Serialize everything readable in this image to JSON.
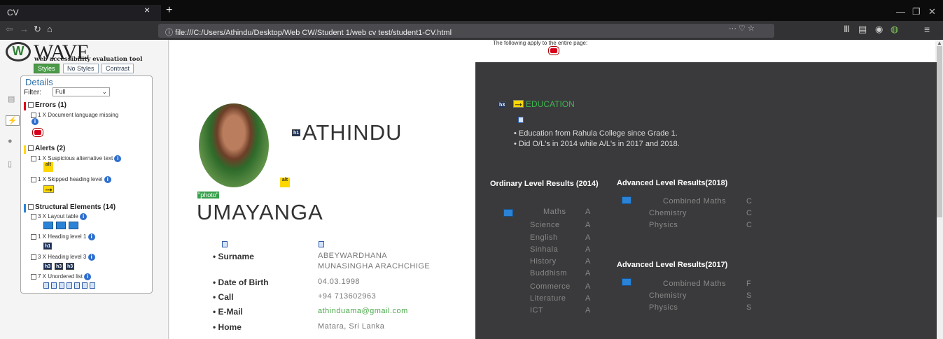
{
  "browser": {
    "tab_title": "CV",
    "tab_close": "×",
    "new_tab": "+",
    "url": "file:///C:/Users/Athindu/Desktop/Web CW/Student 1/web cv test/student1-CV.html",
    "url_actions": "··· ♡ ☆"
  },
  "wave": {
    "logo": "WAVE",
    "tagline": "web accessibility evaluation tool",
    "segments": [
      "Styles",
      "No Styles",
      "Contrast"
    ],
    "details_title": "Details",
    "filter_label": "Filter:",
    "filter_value": "Full",
    "errors": {
      "heading": "Errors (1)",
      "items": [
        "1 X Document language missing"
      ]
    },
    "alerts": {
      "heading": "Alerts (2)",
      "items": [
        "1 X Suspicious alternative text",
        "1 X Skipped heading level"
      ]
    },
    "structural": {
      "heading": "Structural Elements (14)",
      "items": [
        "3 X Layout table",
        "1 X Heading level 1",
        "3 X Heading level 3",
        "7 X Unordered list"
      ]
    },
    "icons": {
      "alt": "alt",
      "h1": "h1",
      "h3": "h3"
    }
  },
  "page": {
    "notice": "The following apply to the entire page:",
    "photo_label": "photo",
    "first_name": "ATHINDU",
    "last_name": "UMAYANGA",
    "details": [
      {
        "label": "Surname",
        "value": "ABEYWARDHANA MUNASINGHA ARACHCHIGE"
      },
      {
        "label": "Date of Birth",
        "value": "04.03.1998"
      },
      {
        "label": "Call",
        "value": "+94 713602963"
      },
      {
        "label": "E-Mail",
        "value": "athinduama@gmail.com"
      },
      {
        "label": "Home",
        "value": "Matara, Sri Lanka"
      }
    ],
    "education": {
      "heading": "EDUCATION",
      "items": [
        "Education from Rahula College since Grade 1.",
        "Did O/L's in 2014 while A/L's in 2017 and 2018."
      ]
    },
    "ol": {
      "heading": "Ordinary Level Results (2014)",
      "subjects": [
        [
          "Maths",
          "A"
        ],
        [
          "Science",
          "A"
        ],
        [
          "English",
          "A"
        ],
        [
          "Sinhala",
          "A"
        ],
        [
          "History",
          "A"
        ],
        [
          "Buddhism",
          "A"
        ],
        [
          "Commerce",
          "A"
        ],
        [
          "Literature",
          "A"
        ],
        [
          "ICT",
          "A"
        ]
      ]
    },
    "al2018": {
      "heading": "Advanced Level Results(2018)",
      "subjects": [
        [
          "Combined Maths",
          "C"
        ],
        [
          "Chemistry",
          "C"
        ],
        [
          "Physics",
          "C"
        ]
      ]
    },
    "al2017": {
      "heading": "Advanced Level Results(2017)",
      "subjects": [
        [
          "Combined Maths",
          "F"
        ],
        [
          "Chemistry",
          "S"
        ],
        [
          "Physics",
          "S"
        ]
      ]
    }
  },
  "colors": {
    "email": "#4aa84a",
    "education_heading": "#3fb34f"
  }
}
